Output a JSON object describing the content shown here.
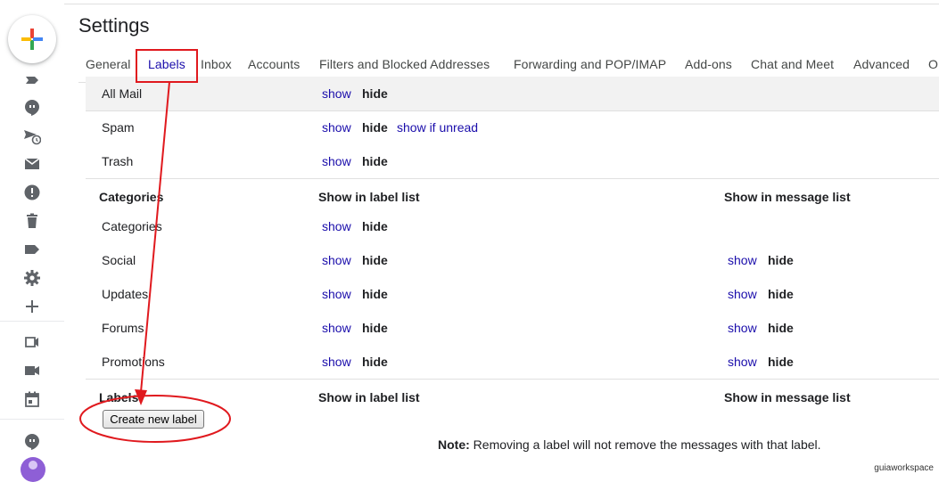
{
  "page_title": "Settings",
  "tabs": [
    {
      "label": "General",
      "active": false
    },
    {
      "label": "Labels",
      "active": true
    },
    {
      "label": "Inbox",
      "active": false
    },
    {
      "label": "Accounts",
      "active": false
    },
    {
      "label": "Filters and Blocked Addresses",
      "active": false
    },
    {
      "label": "Forwarding and POP/IMAP",
      "active": false
    },
    {
      "label": "Add-ons",
      "active": false
    },
    {
      "label": "Chat and Meet",
      "active": false
    },
    {
      "label": "Advanced",
      "active": false
    },
    {
      "label": "O",
      "active": false
    }
  ],
  "system_labels": [
    {
      "name": "All Mail",
      "show": "show",
      "hide": "hide"
    },
    {
      "name": "Spam",
      "show": "show",
      "hide": "hide",
      "extra": "show if unread"
    },
    {
      "name": "Trash",
      "show": "show",
      "hide": "hide"
    }
  ],
  "categories_header": {
    "title": "Categories",
    "col1": "Show in label list",
    "col2": "Show in message list"
  },
  "categories": [
    {
      "name": "Categories",
      "show": "show",
      "hide": "hide"
    },
    {
      "name": "Social",
      "show": "show",
      "hide": "hide",
      "msg_show": "show",
      "msg_hide": "hide"
    },
    {
      "name": "Updates",
      "show": "show",
      "hide": "hide",
      "msg_show": "show",
      "msg_hide": "hide"
    },
    {
      "name": "Forums",
      "show": "show",
      "hide": "hide",
      "msg_show": "show",
      "msg_hide": "hide"
    },
    {
      "name": "Promotions",
      "show": "show",
      "hide": "hide",
      "msg_show": "show",
      "msg_hide": "hide"
    }
  ],
  "labels_header": {
    "title": "Labels",
    "col1": "Show in label list",
    "col2": "Show in message list"
  },
  "create_label_button": "Create new label",
  "note": {
    "prefix": "Note:",
    "text": " Removing a label will not remove the messages with that label."
  },
  "watermark": "guiaworkspace",
  "rail_icons": [
    "label-icon",
    "chat-bubble-icon",
    "scheduled-icon",
    "mail-icon",
    "important-icon",
    "trash-icon",
    "label-tag-icon",
    "gear-icon",
    "plus-icon",
    "meet-new-icon",
    "video-icon",
    "calendar-icon",
    "hangouts-icon"
  ],
  "colors": {
    "link": "#1a0dab",
    "annotation": "#e0191e",
    "shaded_row": "#f2f2f2"
  }
}
